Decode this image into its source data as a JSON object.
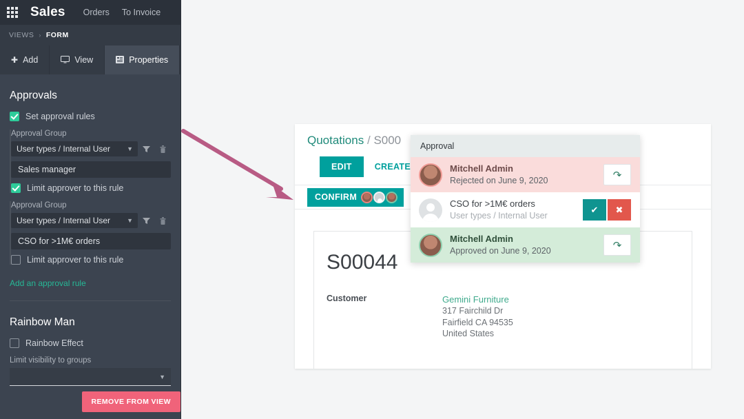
{
  "sidebar": {
    "navbar": {
      "apps_icon": "apps-grid-icon",
      "brand": "Sales",
      "links": [
        "Orders",
        "To Invoice"
      ]
    },
    "breadcrumb": {
      "root": "VIEWS",
      "separator": "›",
      "current": "FORM"
    },
    "tabs": [
      {
        "label": "Add",
        "icon": "plus-icon",
        "active": false
      },
      {
        "label": "View",
        "icon": "monitor-icon",
        "active": false
      },
      {
        "label": "Properties",
        "icon": "list-icon",
        "active": true
      }
    ],
    "approvals": {
      "title": "Approvals",
      "set_rules": {
        "label": "Set approval rules",
        "checked": true
      },
      "rules": [
        {
          "group_label": "Approval Group",
          "group_value": "User types / Internal User",
          "filter_icon": "filter-icon",
          "delete_icon": "trash-icon",
          "name": "Sales manager",
          "limit_label": "Limit approver to this rule",
          "limit_checked": true
        },
        {
          "group_label": "Approval Group",
          "group_value": "User types / Internal User",
          "filter_icon": "filter-icon",
          "delete_icon": "trash-icon",
          "name": "CSO for >1M€ orders",
          "limit_label": "Limit approver to this rule",
          "limit_checked": false
        }
      ],
      "add_link": "Add an approval rule"
    },
    "rainbow": {
      "title": "Rainbow Man",
      "effect": {
        "label": "Rainbow Effect",
        "checked": false
      },
      "visibility_label": "Limit visibility to groups",
      "visibility_value": ""
    },
    "remove_button": "REMOVE FROM VIEW"
  },
  "form": {
    "breadcrumb": {
      "parent": "Quotations",
      "separator": "/",
      "current": "S000"
    },
    "buttons": {
      "edit": "EDIT",
      "create": "CREATE",
      "confirm": "CONFIRM"
    },
    "confirm_avatars": [
      "avatar-rejected",
      "avatar-pending",
      "avatar-approved"
    ],
    "record": {
      "number": "S00044",
      "customer_label": "Customer",
      "customer_name": "Gemini Furniture",
      "customer_address": [
        "317 Fairchild Dr",
        "Fairfield CA 94535",
        "United States"
      ]
    }
  },
  "popup": {
    "title": "Approval",
    "rows": [
      {
        "state": "rejected",
        "avatar": "avatar-photo",
        "name": "Mitchell Admin",
        "detail": "Rejected on June 9, 2020",
        "action": "reset",
        "action_icon": "undo-icon"
      },
      {
        "state": "pending",
        "avatar": "avatar-placeholder",
        "name": "CSO for >1M€ orders",
        "detail": "User types / Internal User",
        "action": "approve-reject",
        "approve_icon": "check-icon",
        "reject_icon": "cross-icon"
      },
      {
        "state": "approved",
        "avatar": "avatar-photo",
        "name": "Mitchell Admin",
        "detail": "Approved on June 9, 2020",
        "action": "reset",
        "action_icon": "undo-icon"
      }
    ]
  },
  "annotation": {
    "arrow": "pink-arrow",
    "color": "#b85b84"
  },
  "colors": {
    "sidebar_bg": "#3c4450",
    "navbar_bg": "#2b313a",
    "accent_teal": "#00a09d",
    "accent_green": "#2ecc9a",
    "danger": "#f0637a",
    "rejected_bg": "#fadcdb",
    "approved_bg": "#d4ecd9"
  }
}
